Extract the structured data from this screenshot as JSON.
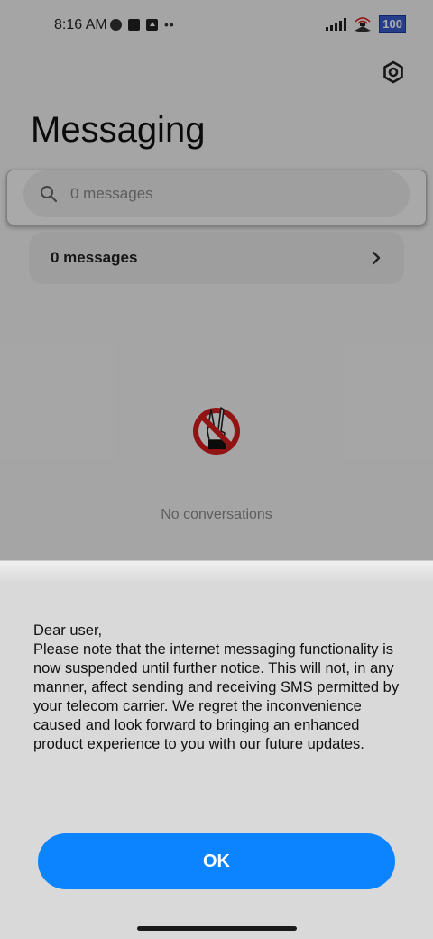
{
  "status_bar": {
    "time": "8:16 AM",
    "battery": "100"
  },
  "header": {
    "title": "Messaging",
    "settings_icon": "gear-icon"
  },
  "search": {
    "placeholder": "0 messages",
    "icon": "search-icon"
  },
  "messages_row": {
    "label": "0 messages",
    "icon": "chevron-right-icon"
  },
  "empty_state": {
    "label": "No conversations",
    "icon": "no-messaging-hand-icon"
  },
  "dialog": {
    "message": "Dear user,\nPlease note that the internet messaging functionality is now suspended until further notice. This will not, in any manner, affect sending and receiving SMS permitted by your telecom carrier. We regret the inconvenience caused and look forward to bringing an enhanced product experience to you with our future updates.",
    "ok_label": "OK"
  },
  "colors": {
    "accent": "#0d84ff",
    "sheet": "#d9d9d9",
    "prohibition_red": "#d81e1e"
  }
}
